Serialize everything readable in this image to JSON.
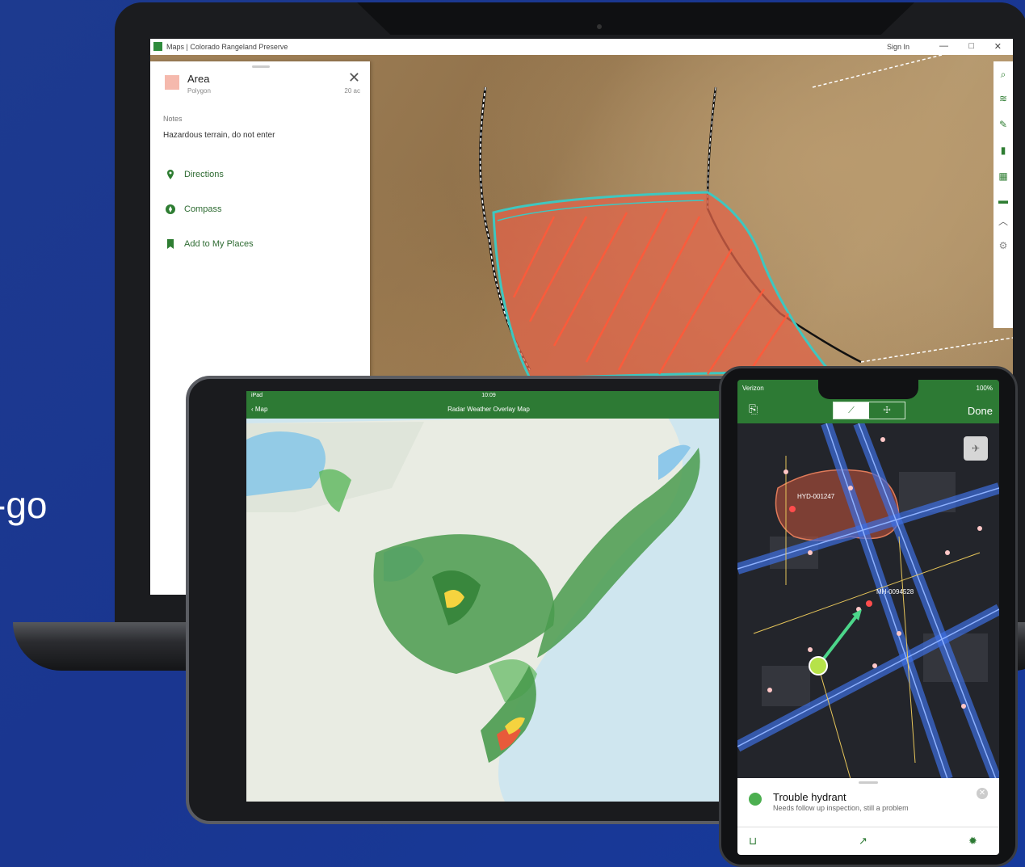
{
  "tagline": "-go",
  "colors": {
    "brand_green": "#2d7a34",
    "background_blue": "#1a3690",
    "area_fill": "#e0644a",
    "area_outline": "#3ec7c0"
  },
  "laptop": {
    "window_title": "Maps | Colorado Rangeland Preserve",
    "user_label": "Sign In",
    "window_controls": [
      "—",
      "□",
      "✕"
    ],
    "panel": {
      "title": "Area",
      "subtitle": "Polygon",
      "meta": "20 ac",
      "notes_label": "Notes",
      "notes_value": "Hazardous terrain, do not enter",
      "actions": [
        {
          "label": "Directions",
          "icon": "map-pin-icon"
        },
        {
          "label": "Compass",
          "icon": "compass-icon"
        },
        {
          "label": "Add to My Places",
          "icon": "bookmark-icon"
        }
      ]
    },
    "tools": [
      "search-icon",
      "layers-icon",
      "pencil-icon",
      "bookmark-icon",
      "grid-icon",
      "ruler-icon",
      "chevron-up-icon",
      "settings-icon"
    ]
  },
  "tablet": {
    "status_time": "10:09",
    "status_left": "iPad",
    "back_label": "Map",
    "nav_title": "Radar Weather Overlay Map"
  },
  "phone": {
    "status_carrier": "Verizon",
    "status_right": "100%",
    "done_label": "Done",
    "map_labels": [
      "HYD-001247",
      "MH-0094528"
    ],
    "card": {
      "title": "Trouble hydrant",
      "desc": "Needs follow up inspection, still a problem"
    }
  }
}
